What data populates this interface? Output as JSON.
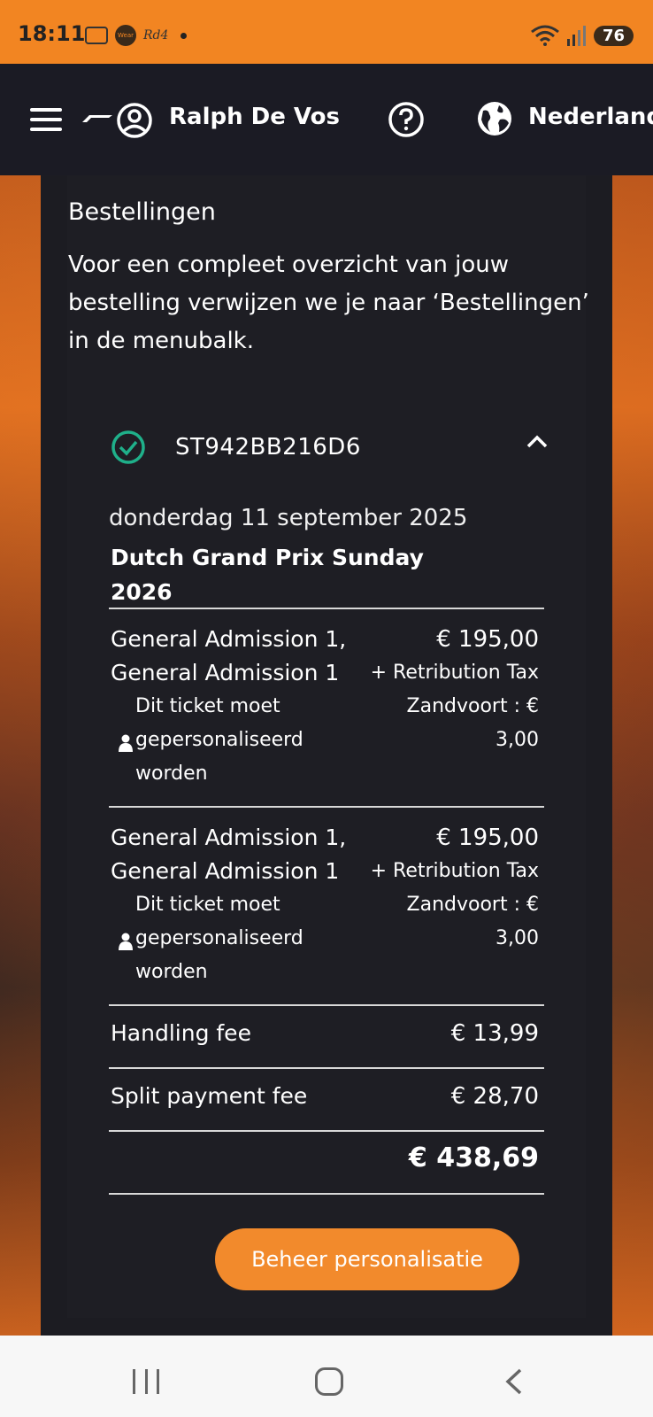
{
  "status_bar": {
    "time": "18:11",
    "app_badge": "Wear",
    "app_text": "Rd4",
    "battery": "76"
  },
  "header": {
    "user_name": "Ralph De Vos",
    "language": "Nederlands"
  },
  "orders": {
    "title": "Bestellingen",
    "intro": "Voor een compleet overzicht van jouw bestelling verwijzen we je naar ‘Bestellingen’ in de menubalk.",
    "order_id": "ST942BB216D6",
    "date": "donderdag 11 september 2025",
    "event": "Dutch Grand Prix Sunday 2026",
    "items": [
      {
        "name": "General Admission 1, General Admission 1",
        "note": "Dit ticket moet gepersonaliseerd worden",
        "price": "€ 195,00",
        "tax": "+ Retribution Tax Zandvoort : € 3,00"
      },
      {
        "name": "General Admission 1, General Admission 1",
        "note": "Dit ticket moet gepersonaliseerd worden",
        "price": "€ 195,00",
        "tax": "+ Retribution Tax Zandvoort : € 3,00"
      }
    ],
    "handling_fee_label": "Handling fee",
    "handling_fee_value": "€ 13,99",
    "split_fee_label": "Split payment fee",
    "split_fee_value": "€ 28,70",
    "total": "€ 438,69",
    "manage_button": "Beheer personalisatie"
  },
  "colors": {
    "accent": "#f28a2c",
    "success": "#1fb08a",
    "statusbar": "#f28522"
  }
}
